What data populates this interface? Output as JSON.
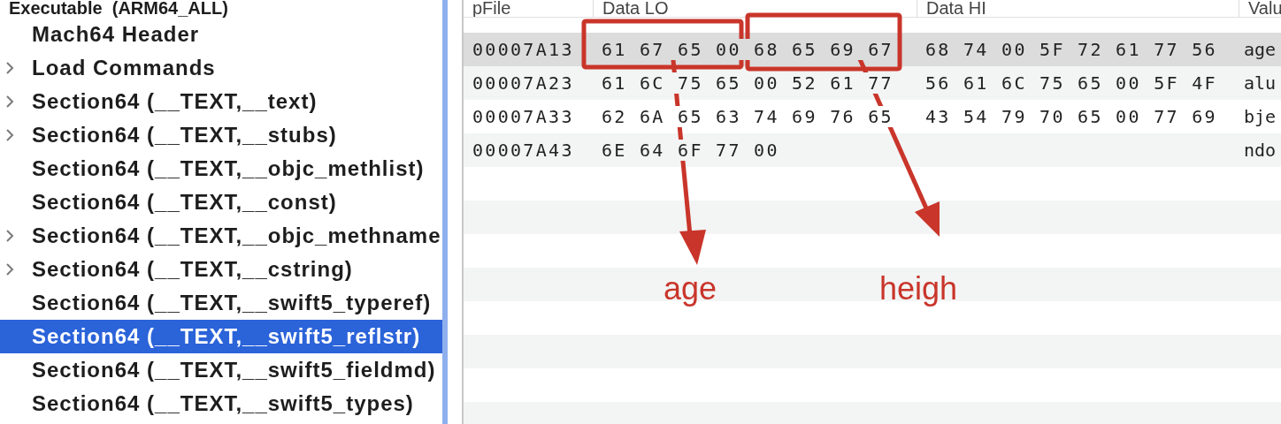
{
  "tree": {
    "label": "Executable  (ARM64_ALL)",
    "children": [
      {
        "label": "Mach64 Header",
        "expandable": false,
        "selected": false
      },
      {
        "label": "Load Commands",
        "expandable": true,
        "selected": false
      },
      {
        "label": "Section64 (__TEXT,__text)",
        "expandable": true,
        "selected": false
      },
      {
        "label": "Section64 (__TEXT,__stubs)",
        "expandable": true,
        "selected": false
      },
      {
        "label": "Section64 (__TEXT,__objc_methlist)",
        "expandable": false,
        "selected": false
      },
      {
        "label": "Section64 (__TEXT,__const)",
        "expandable": false,
        "selected": false
      },
      {
        "label": "Section64 (__TEXT,__objc_methname",
        "expandable": true,
        "selected": false
      },
      {
        "label": "Section64 (__TEXT,__cstring)",
        "expandable": true,
        "selected": false
      },
      {
        "label": "Section64 (__TEXT,__swift5_typeref)",
        "expandable": false,
        "selected": false
      },
      {
        "label": "Section64 (__TEXT,__swift5_reflstr)",
        "expandable": false,
        "selected": true
      },
      {
        "label": "Section64 (__TEXT,__swift5_fieldmd)",
        "expandable": false,
        "selected": false
      },
      {
        "label": "Section64 (__TEXT,__swift5_types)",
        "expandable": false,
        "selected": false
      }
    ]
  },
  "table": {
    "columns": [
      "pFile",
      "Data LO",
      "Data HI",
      "Valu"
    ],
    "rows": [
      {
        "pfile": "00007A13",
        "data_lo": "61 67 65 00 68 65 69 67",
        "data_hi": "68 74 00 5F 72 61 77 56",
        "value": "age",
        "selected": true
      },
      {
        "pfile": "00007A23",
        "data_lo": "61 6C 75 65 00 52 61 77",
        "data_hi": "56 61 6C 75 65 00 5F 4F",
        "value": "alu",
        "selected": false
      },
      {
        "pfile": "00007A33",
        "data_lo": "62 6A 65 63 74 69 76 65",
        "data_hi": "43 54 79 70 65 00 77 69",
        "value": "bje",
        "selected": false
      },
      {
        "pfile": "00007A43",
        "data_lo": "6E 64 6F 77 00",
        "data_hi": "",
        "value": "ndo",
        "selected": false
      }
    ]
  },
  "annotations": [
    {
      "label": "age"
    },
    {
      "label": "heigh"
    }
  ]
}
